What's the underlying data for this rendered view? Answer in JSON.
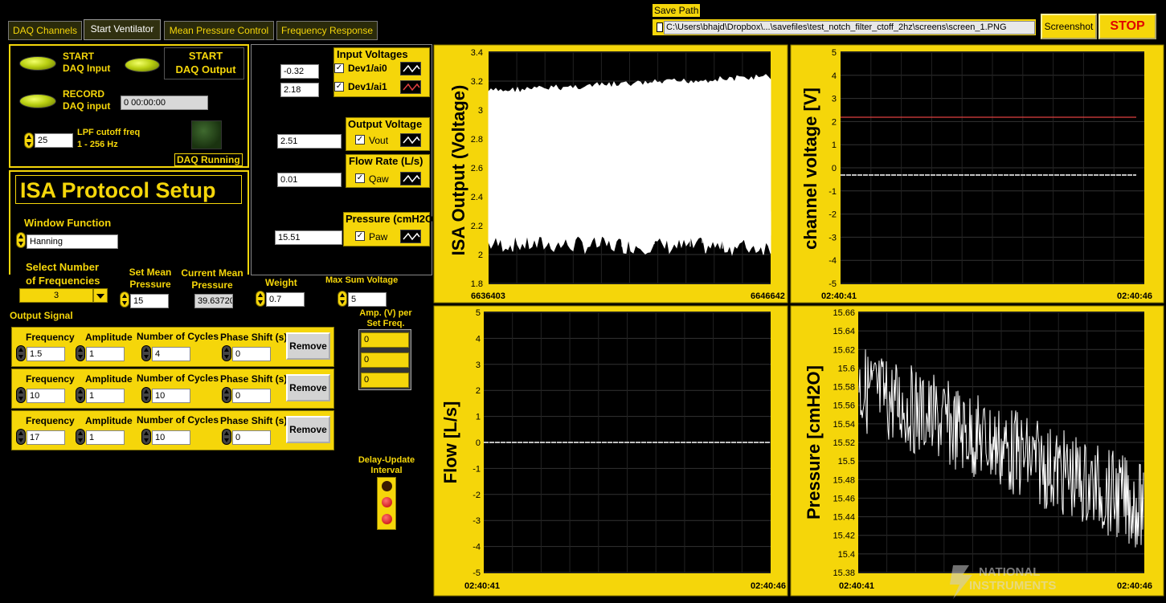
{
  "tabs": [
    "DAQ Channels",
    "Start Ventilator",
    "Mean Pressure Control",
    "Frequency Response"
  ],
  "save_path": {
    "label": "Save Path",
    "value": "C:\\Users\\bhajd\\Dropbox\\...\\savefiles\\test_notch_filter_ctoff_2hz\\screens\\screen_1.PNG"
  },
  "screenshot_label": "Screenshot",
  "stop_label": "STOP",
  "daq": {
    "start_input": "START\nDAQ Input",
    "start_input_l1": "START",
    "start_input_l2": "DAQ Input",
    "start_output_l1": "START",
    "start_output_l2": "DAQ Output",
    "record_l1": "RECORD",
    "record_l2": "DAQ input",
    "record_time": "0  00:00:00",
    "lpf_value": "25",
    "lpf_l1": "LPF cutoff freq",
    "lpf_l2": "1 - 256 Hz",
    "running_label": "DAQ Running"
  },
  "channels": {
    "input_voltages_title": "Input Voltages",
    "ai0_value": "-0.32",
    "ai0_label": "Dev1/ai0",
    "ai1_value": "2.18",
    "ai1_label": "Dev1/ai1",
    "output_voltage_title": "Output Voltage",
    "vout_value": "2.51",
    "vout_label": "Vout",
    "flow_title": "Flow Rate (L/s)",
    "qaw_value": "0.01",
    "qaw_label": "Qaw",
    "pressure_title": "Pressure (cmH2O",
    "paw_value": "15.51",
    "paw_label": "Paw"
  },
  "isa": {
    "title": "ISA Protocol Setup",
    "window_function_label": "Window Function",
    "window_function_value": "Hanning",
    "num_freq_l1": "Select Number",
    "num_freq_l2": "of Frequencies",
    "num_freq_value": "3",
    "set_mean_l1": "Set Mean",
    "set_mean_l2": "Pressure",
    "set_mean_value": "15",
    "current_mean_l1": "Current Mean",
    "current_mean_l2": "Pressure",
    "current_mean_value": "39.63720",
    "weight_label": "Weight",
    "weight_value": "0.7",
    "max_sum_label": "Max Sum Voltage",
    "max_sum_value": "5",
    "output_signal_label": "Output Signal",
    "amp_l1": "Amp. (V) per",
    "amp_l2": "Set Freq.",
    "amp_values": [
      "0",
      "0",
      "0"
    ],
    "delay_l1": "Delay-Update",
    "delay_l2": "Interval",
    "row_headers": {
      "frequency": "Frequency",
      "amplitude": "Amplitude",
      "cycles": "Number of Cycles",
      "phase": "Phase Shift (s)",
      "remove": "Remove"
    },
    "rows": [
      {
        "frequency": "1.5",
        "amplitude": "1",
        "cycles": "4",
        "phase": "0"
      },
      {
        "frequency": "10",
        "amplitude": "1",
        "cycles": "10",
        "phase": "0"
      },
      {
        "frequency": "17",
        "amplitude": "1",
        "cycles": "10",
        "phase": "0"
      }
    ]
  },
  "charts": {
    "isa_output": {
      "ylabel": "ISA Output (Voltage)",
      "yticks": [
        "3.4",
        "3.2",
        "3",
        "2.8",
        "2.6",
        "2.4",
        "2.2",
        "2",
        "1.8"
      ],
      "xticks": [
        "6636403",
        "6646642"
      ]
    },
    "channel_voltage": {
      "ylabel": "channel voltage [V]",
      "yticks": [
        "5",
        "4",
        "3",
        "2",
        "1",
        "0",
        "-1",
        "-2",
        "-3",
        "-4",
        "-5"
      ],
      "xticks": [
        "02:40:41",
        "02:40:46"
      ]
    },
    "flow": {
      "ylabel": "Flow [L/s]",
      "yticks": [
        "5",
        "4",
        "3",
        "2",
        "1",
        "0",
        "-1",
        "-2",
        "-3",
        "-4",
        "-5"
      ],
      "xticks": [
        "02:40:41",
        "02:40:46"
      ]
    },
    "pressure": {
      "ylabel": "Pressure [cmH2O]",
      "yticks": [
        "15.66",
        "15.64",
        "15.62",
        "15.6",
        "15.58",
        "15.56",
        "15.54",
        "15.52",
        "15.5",
        "15.48",
        "15.46",
        "15.44",
        "15.42",
        "15.4",
        "15.38"
      ],
      "xticks": [
        "02:40:41",
        "02:40:46"
      ]
    }
  },
  "watermark": {
    "l1": "NATIONAL",
    "l2": "INSTRUMENTS"
  },
  "colors": {
    "accent": "#f5d60a",
    "background": "#000000",
    "trace": "#ffffff",
    "red_trace": "#e04040"
  }
}
